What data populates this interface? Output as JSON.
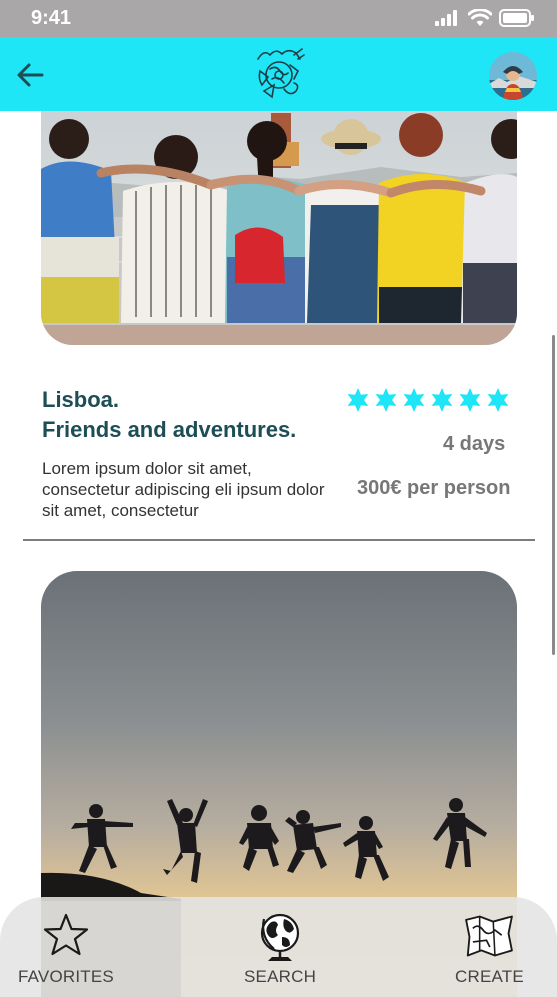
{
  "status_bar": {
    "time": "9:41"
  },
  "header": {
    "back_icon": "arrow-left-icon",
    "logo_icon": "travel-logo-icon",
    "avatar": "user-avatar",
    "color": "#1ee6f6"
  },
  "trips": [
    {
      "title_line1": "Lisboa.",
      "title_line2": "Friends and adventures.",
      "description": "Lorem ipsum dolor sit amet, consectetur adipiscing eli ipsum dolor sit amet, consectetur",
      "rating": 6,
      "rating_max": 6,
      "duration": "4 days",
      "price": "300€ per person"
    },
    {}
  ],
  "nav": {
    "favorites_label": "FAVORITES",
    "search_label": "SEARCH",
    "create_label": "CREATE"
  },
  "colors": {
    "accent": "#1ee6f6",
    "title": "#1d4d55",
    "star": "#1ee6f6"
  }
}
